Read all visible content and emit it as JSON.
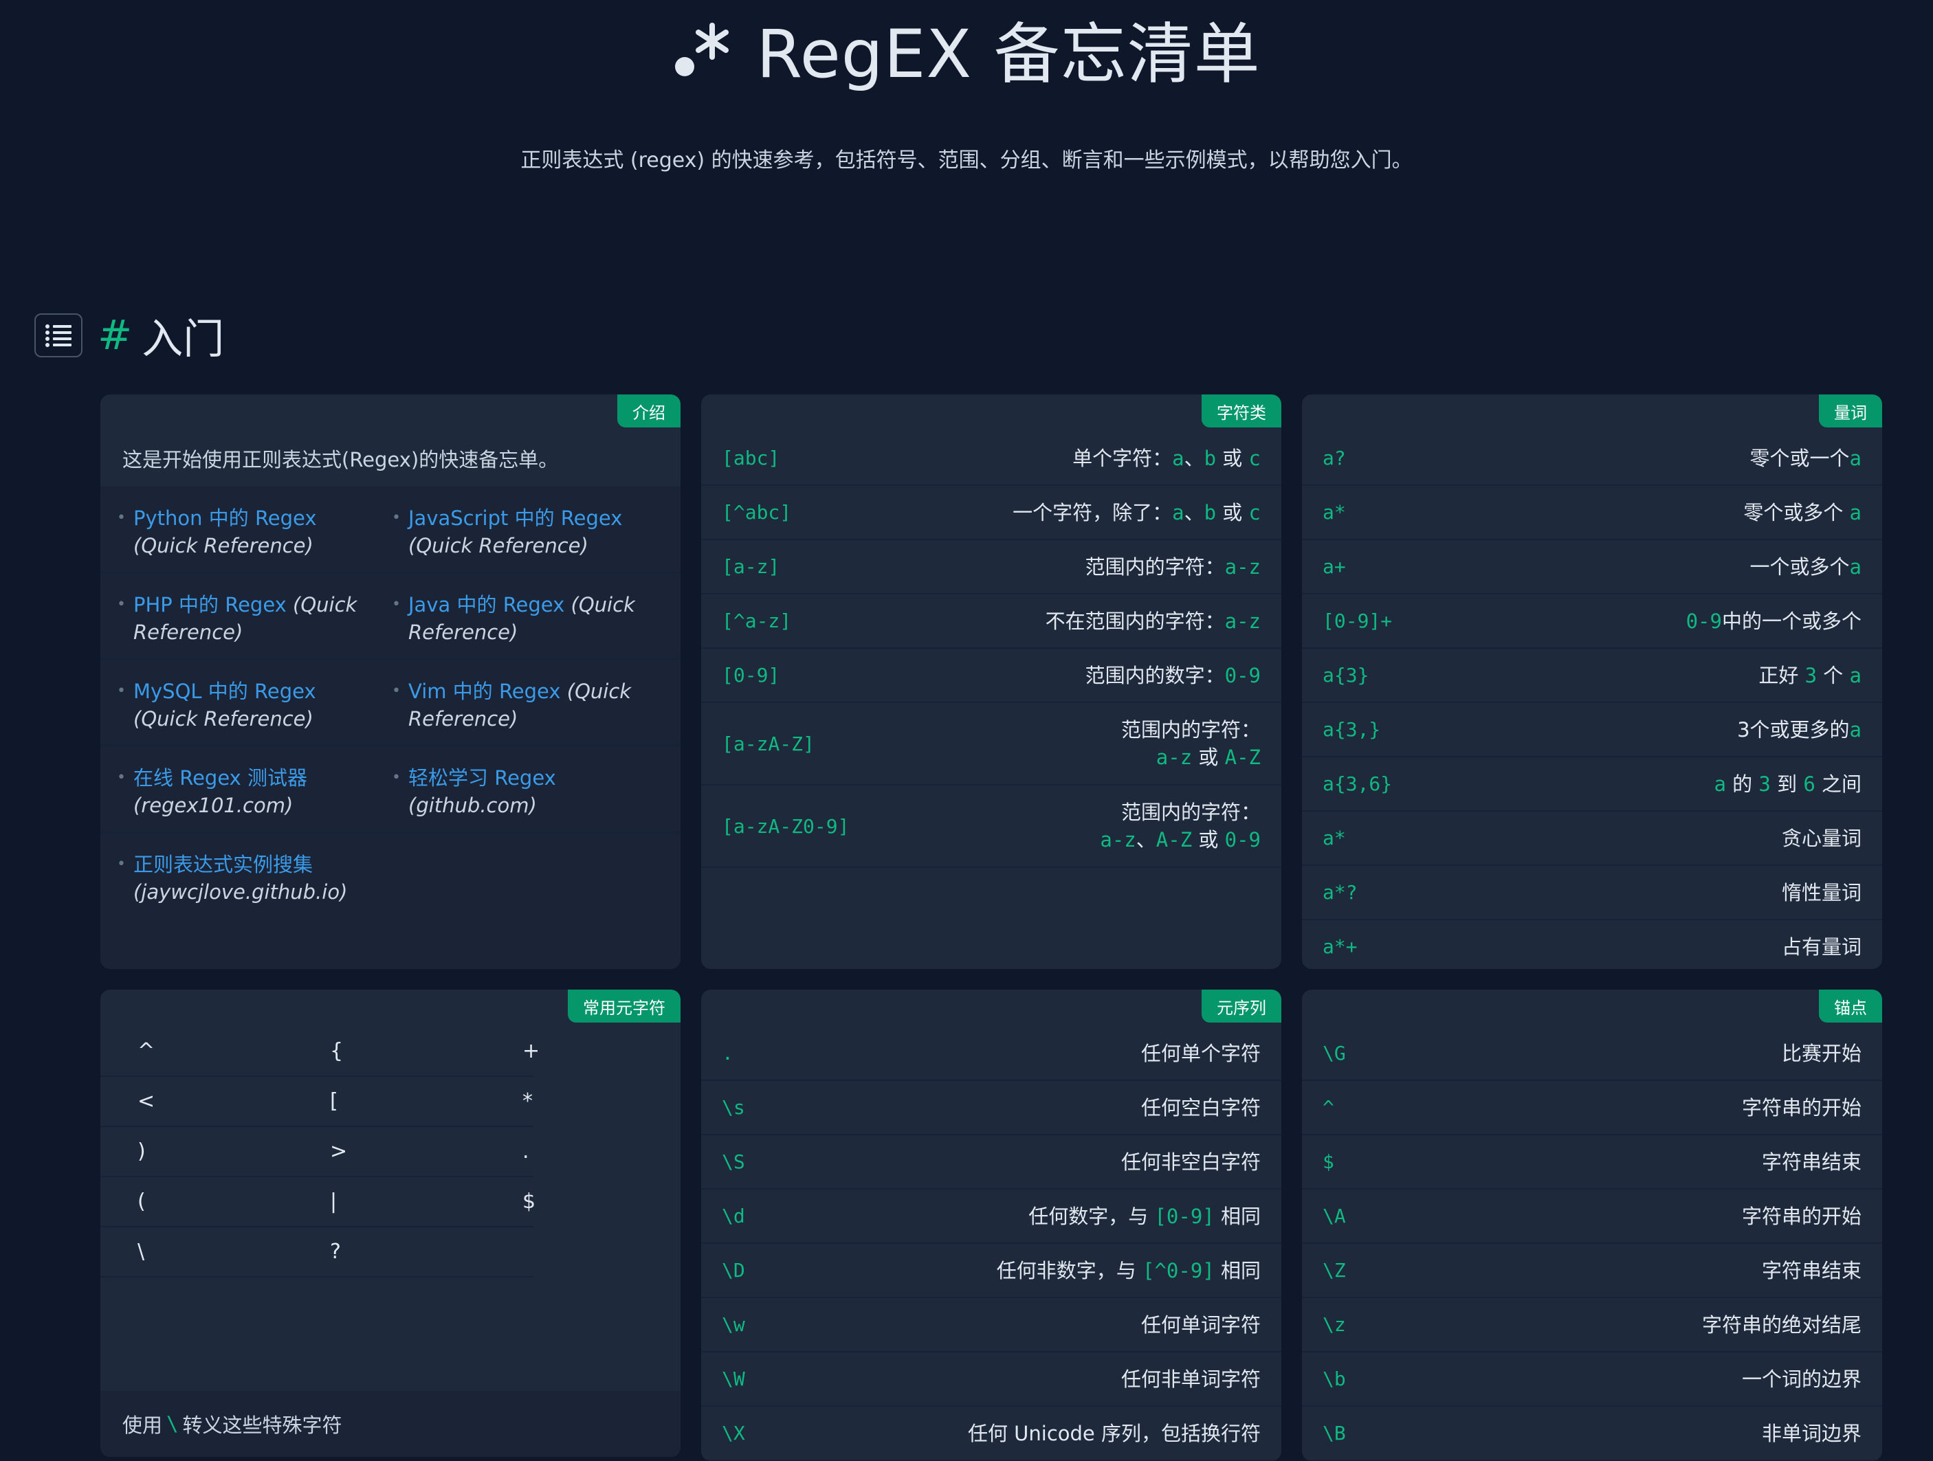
{
  "header": {
    "title": "RegEX 备忘清单",
    "subtitle": "正则表达式 (regex) 的快速参考，包括符号、范围、分组、断言和一些示例模式，以帮助您入门。"
  },
  "section": {
    "hash": "#",
    "title": "入门"
  },
  "intro": {
    "tag": "介绍",
    "text": "这是开始使用正则表达式(Regex)的快速备忘单。",
    "links": [
      [
        {
          "link": "Python 中的 Regex",
          "note": "(Quick Reference)"
        },
        {
          "link": "JavaScript 中的 Regex",
          "note": "(Quick Reference)"
        }
      ],
      [
        {
          "link": "PHP 中的 Regex",
          "note": "(Quick Reference)"
        },
        {
          "link": "Java 中的 Regex",
          "note": "(Quick Reference)"
        }
      ],
      [
        {
          "link": "MySQL 中的 Regex",
          "note": "(Quick Reference)"
        },
        {
          "link": "Vim 中的 Regex",
          "note": "(Quick Reference)"
        }
      ],
      [
        {
          "link": "在线 Regex 测试器",
          "note": "(regex101.com)"
        },
        {
          "link": "轻松学习 Regex",
          "note": "(github.com)"
        }
      ],
      [
        {
          "link": "正则表达式实例搜集",
          "note": "(jaywcjlove.github.io)"
        }
      ]
    ]
  },
  "charclass": {
    "tag": "字符类",
    "rows": [
      {
        "code": "[abc]",
        "desc": [
          [
            "单个字符：",
            ""
          ],
          [
            "a",
            "c"
          ],
          [
            "、",
            ""
          ],
          [
            "b",
            "c"
          ],
          [
            " 或 ",
            ""
          ],
          [
            "c",
            "c"
          ]
        ]
      },
      {
        "code": "[^abc]",
        "desc": [
          [
            "一个字符，除了：",
            ""
          ],
          [
            "a",
            "c"
          ],
          [
            "、",
            ""
          ],
          [
            "b",
            "c"
          ],
          [
            " 或 ",
            ""
          ],
          [
            "c",
            "c"
          ]
        ]
      },
      {
        "code": "[a-z]",
        "desc": [
          [
            "范围内的字符：",
            ""
          ],
          [
            "a-z",
            "c"
          ]
        ]
      },
      {
        "code": "[^a-z]",
        "desc": [
          [
            "不在范围内的字符：",
            ""
          ],
          [
            "a-z",
            "c"
          ]
        ]
      },
      {
        "code": "[0-9]",
        "desc": [
          [
            "范围内的数字：",
            ""
          ],
          [
            "0-9",
            "c"
          ]
        ]
      },
      {
        "code": "[a-zA-Z]",
        "desc": [
          [
            "范围内的字符：",
            ""
          ],
          [
            "\n",
            "br"
          ],
          [
            "a-z",
            "c"
          ],
          [
            " 或 ",
            ""
          ],
          [
            "A-Z",
            "c"
          ]
        ]
      },
      {
        "code": "[a-zA-Z0-9]",
        "desc": [
          [
            "范围内的字符：",
            ""
          ],
          [
            "\n",
            "br"
          ],
          [
            "a-z",
            "c"
          ],
          [
            "、",
            ""
          ],
          [
            "A-Z",
            "c"
          ],
          [
            " 或 ",
            ""
          ],
          [
            "0-9",
            "c"
          ]
        ]
      }
    ]
  },
  "quantifier": {
    "tag": "量词",
    "rows": [
      {
        "code": "a?",
        "desc": [
          [
            "零个或一个",
            ""
          ],
          [
            "a",
            "c"
          ]
        ]
      },
      {
        "code": "a*",
        "desc": [
          [
            "零个或多个 ",
            ""
          ],
          [
            "a",
            "c"
          ]
        ]
      },
      {
        "code": "a+",
        "desc": [
          [
            "一个或多个",
            ""
          ],
          [
            "a",
            "c"
          ]
        ]
      },
      {
        "code": "[0-9]+",
        "desc": [
          [
            "0-9",
            "c"
          ],
          [
            "中的一个或多个",
            ""
          ]
        ]
      },
      {
        "code": "a{3}",
        "desc": [
          [
            "正好 ",
            ""
          ],
          [
            "3",
            "c"
          ],
          [
            " 个 ",
            ""
          ],
          [
            "a",
            "c"
          ]
        ]
      },
      {
        "code": "a{3,}",
        "desc": [
          [
            "3个或更多的",
            ""
          ],
          [
            "a",
            "c"
          ]
        ]
      },
      {
        "code": "a{3,6}",
        "desc": [
          [
            "a",
            "c"
          ],
          [
            " 的 ",
            ""
          ],
          [
            "3",
            "c"
          ],
          [
            " 到 ",
            ""
          ],
          [
            "6",
            "c"
          ],
          [
            " 之间",
            ""
          ]
        ]
      },
      {
        "code": "a*",
        "desc": [
          [
            "贪心量词",
            ""
          ]
        ]
      },
      {
        "code": "a*?",
        "desc": [
          [
            "惰性量词",
            ""
          ]
        ]
      },
      {
        "code": "a*+",
        "desc": [
          [
            "占有量词",
            ""
          ]
        ]
      }
    ]
  },
  "metachar": {
    "tag": "常用元字符",
    "rows": [
      [
        "^",
        "{",
        "+"
      ],
      [
        "<",
        "[",
        "*"
      ],
      [
        ")",
        ">",
        "."
      ],
      [
        "(",
        "|",
        "$"
      ],
      [
        "\\",
        "?",
        ""
      ]
    ],
    "footer_pre": "使用 ",
    "footer_code": "\\",
    "footer_post": " 转义这些特殊字符"
  },
  "metaseq": {
    "tag": "元序列",
    "rows": [
      {
        "code": ".",
        "desc": [
          [
            "任何单个字符",
            ""
          ]
        ]
      },
      {
        "code": "\\s",
        "desc": [
          [
            "任何空白字符",
            ""
          ]
        ]
      },
      {
        "code": "\\S",
        "desc": [
          [
            "任何非空白字符",
            ""
          ]
        ]
      },
      {
        "code": "\\d",
        "desc": [
          [
            "任何数字，与 ",
            ""
          ],
          [
            "[0-9]",
            "c"
          ],
          [
            " 相同",
            ""
          ]
        ]
      },
      {
        "code": "\\D",
        "desc": [
          [
            "任何非数字，与 ",
            ""
          ],
          [
            "[^0-9]",
            "c"
          ],
          [
            " 相同",
            ""
          ]
        ]
      },
      {
        "code": "\\w",
        "desc": [
          [
            "任何单词字符",
            ""
          ]
        ]
      },
      {
        "code": "\\W",
        "desc": [
          [
            "任何非单词字符",
            ""
          ]
        ]
      },
      {
        "code": "\\X",
        "desc": [
          [
            "任何 Unicode 序列，包括换行符",
            ""
          ]
        ]
      }
    ]
  },
  "anchors": {
    "tag": "锚点",
    "rows": [
      {
        "code": "\\G",
        "desc": [
          [
            "比赛开始",
            ""
          ]
        ]
      },
      {
        "code": "^",
        "desc": [
          [
            "字符串的开始",
            ""
          ]
        ]
      },
      {
        "code": "$",
        "desc": [
          [
            "字符串结束",
            ""
          ]
        ]
      },
      {
        "code": "\\A",
        "desc": [
          [
            "字符串的开始",
            ""
          ]
        ]
      },
      {
        "code": "\\Z",
        "desc": [
          [
            "字符串结束",
            ""
          ]
        ]
      },
      {
        "code": "\\z",
        "desc": [
          [
            "字符串的绝对结尾",
            ""
          ]
        ]
      },
      {
        "code": "\\b",
        "desc": [
          [
            "一个词的边界",
            ""
          ]
        ]
      },
      {
        "code": "\\B",
        "desc": [
          [
            "非单词边界",
            ""
          ]
        ]
      }
    ]
  },
  "colors": {
    "background": "#0f172a",
    "card": "#1e293b",
    "accent": "#10b981",
    "tag": "#059669",
    "link": "#3b9be8"
  }
}
